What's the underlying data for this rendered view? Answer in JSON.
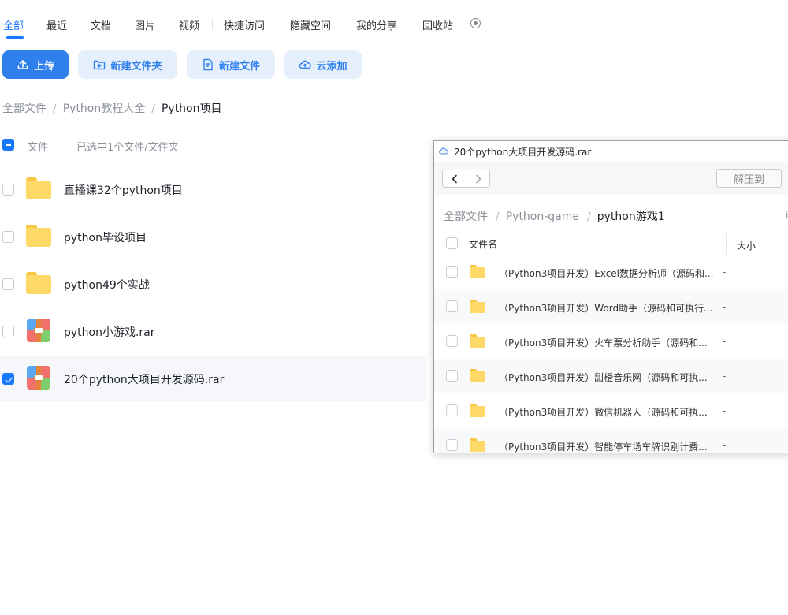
{
  "tabs": [
    "全部",
    "最近",
    "文档",
    "图片",
    "视频",
    "快捷访问",
    "隐藏空间",
    "我的分享",
    "回收站"
  ],
  "active_tab": "全部",
  "toolbar": {
    "upload": "上传",
    "new_folder": "新建文件夹",
    "new_file": "新建文件",
    "cloud_add": "云添加"
  },
  "breadcrumb": [
    "全部文件",
    "Python教程大全",
    "Python项目"
  ],
  "list": {
    "header_label": "文件",
    "selection_status": "已选中1个文件/文件夹",
    "items": [
      {
        "name": "直播课32个python项目",
        "icon": "folder-icon",
        "checked": false
      },
      {
        "name": "python毕设项目",
        "icon": "folder-icon",
        "checked": false
      },
      {
        "name": "python49个实战",
        "icon": "folder-icon",
        "checked": false
      },
      {
        "name": "python小游戏.rar",
        "icon": "rar-icon",
        "checked": false
      },
      {
        "name": "20个python大项目开发源码.rar",
        "icon": "rar-icon",
        "checked": true
      }
    ]
  },
  "popup": {
    "title": "20个python大项目开发源码.rar",
    "extract_label": "解压到",
    "breadcrumb": [
      "全部文件",
      "Python-game",
      "python游戏1"
    ],
    "truncated_glyph": "i",
    "columns": {
      "name": "文件名",
      "size": "大小"
    },
    "rows": [
      {
        "name": "（Python3项目开发）Excel数据分析师（源码和...",
        "size": "-"
      },
      {
        "name": "（Python3项目开发）Word助手（源码和可执行...",
        "size": "-"
      },
      {
        "name": "（Python3项目开发）火车票分析助手（源码和...",
        "size": "-"
      },
      {
        "name": "（Python3项目开发）甜橙音乐网（源码和可执...",
        "size": "-"
      },
      {
        "name": "（Python3项目开发）微信机器人（源码和可执...",
        "size": "-"
      },
      {
        "name": "（Python3项目开发）智能停车场车牌识别计费...",
        "size": "-"
      }
    ]
  },
  "colors": {
    "accent": "#1677ff",
    "primary_button": "#2f80ed",
    "light_button": "#e6f0fd",
    "folder": "#ffd968"
  }
}
